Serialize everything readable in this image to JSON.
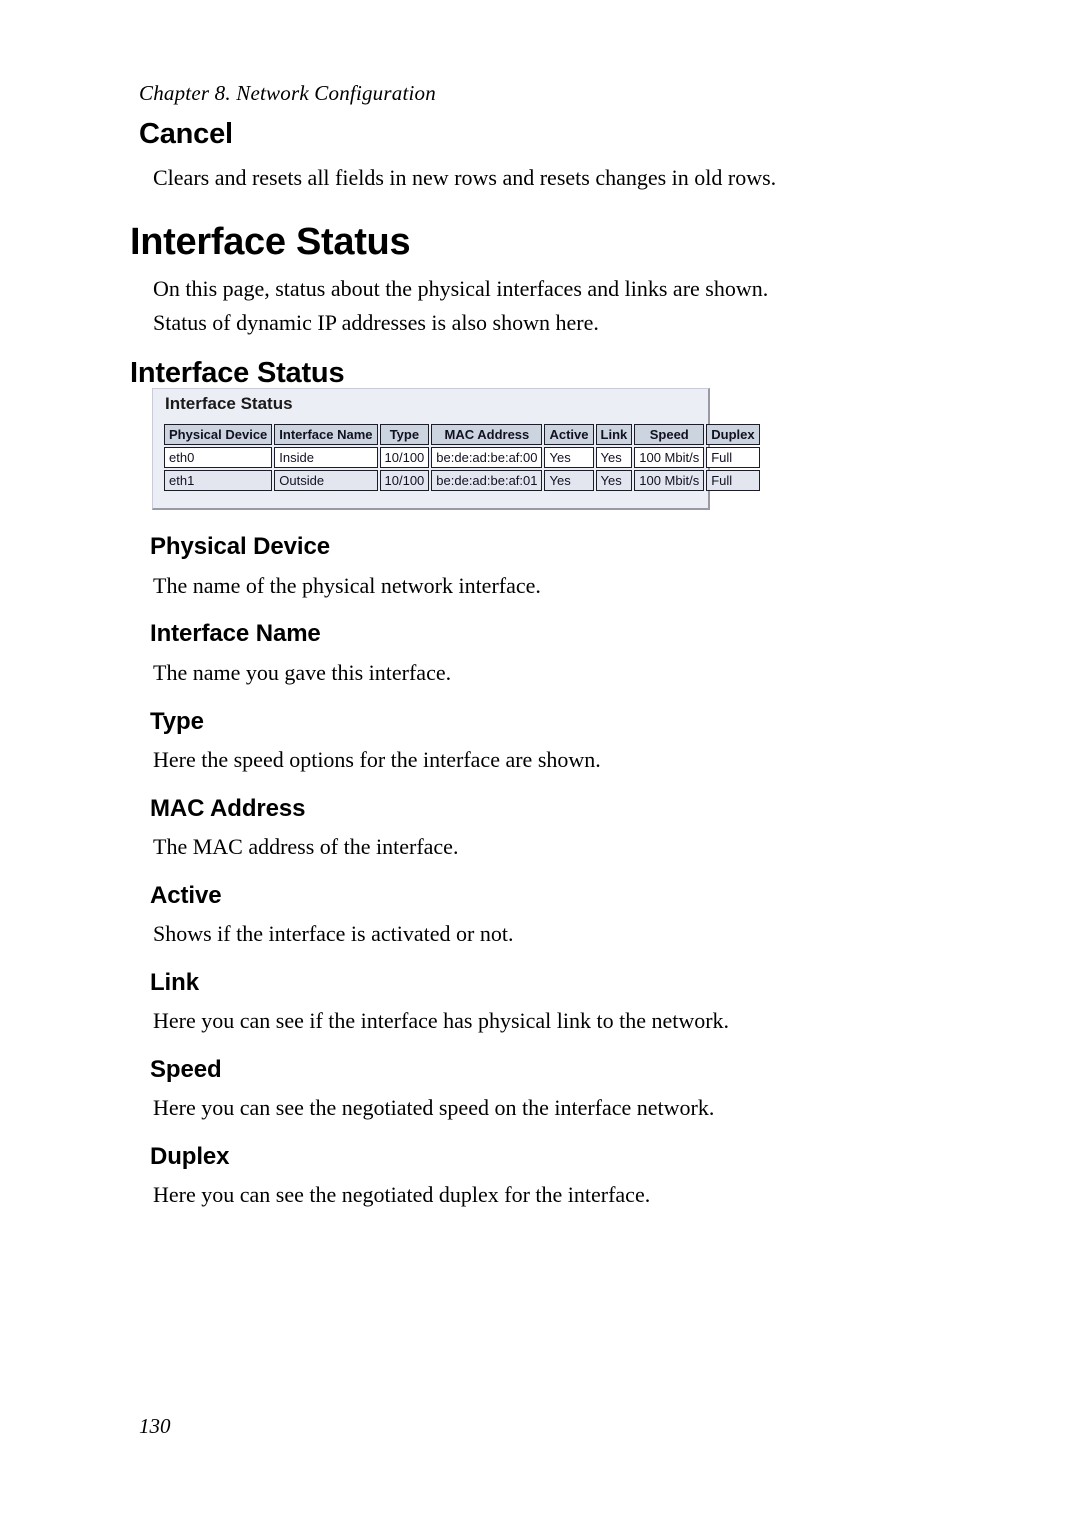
{
  "page": {
    "running_head": "Chapter 8. Network Configuration",
    "folio": "130"
  },
  "sections": {
    "cancel": {
      "heading": "Cancel",
      "body": "Clears and resets all fields in new rows and resets changes in old rows."
    },
    "interface_status": {
      "heading": "Interface Status",
      "body_line1": "On this page, status about the physical interfaces and links are shown.",
      "body_line2": "Status of dynamic IP addresses is also shown here.",
      "subheading": "Interface Status"
    },
    "physical_device": {
      "heading": "Physical Device",
      "body": "The name of the physical network interface."
    },
    "interface_name": {
      "heading": "Interface Name",
      "body": "The name you gave this interface."
    },
    "type": {
      "heading": "Type",
      "body": "Here the speed options for the interface are shown."
    },
    "mac_address": {
      "heading": "MAC Address",
      "body": "The MAC address of the interface."
    },
    "active": {
      "heading": "Active",
      "body": "Shows if the interface is activated or not."
    },
    "link": {
      "heading": "Link",
      "body": "Here you can see if the interface has physical link to the network."
    },
    "speed": {
      "heading": "Speed",
      "body": "Here you can see the negotiated speed on the interface network."
    },
    "duplex": {
      "heading": "Duplex",
      "body": "Here you can see the negotiated duplex for the interface."
    }
  },
  "screenshot": {
    "panel_title": "Interface Status",
    "colors": {
      "panel_background": "#eceef5",
      "header_cell_background": "#ccd4e0",
      "row_odd_background": "#ffffff",
      "row_even_background": "#e3e6ef",
      "cell_border": "#1c1c28"
    },
    "table": {
      "columns": [
        "Physical Device",
        "Interface Name",
        "Type",
        "MAC Address",
        "Active",
        "Link",
        "Speed",
        "Duplex"
      ],
      "rows": [
        {
          "physical_device": "eth0",
          "interface_name": "Inside",
          "type": "10/100",
          "mac_address": "be:de:ad:be:af:00",
          "active": "Yes",
          "link": "Yes",
          "speed": "100 Mbit/s",
          "duplex": "Full"
        },
        {
          "physical_device": "eth1",
          "interface_name": "Outside",
          "type": "10/100",
          "mac_address": "be:de:ad:be:af:01",
          "active": "Yes",
          "link": "Yes",
          "speed": "100 Mbit/s",
          "duplex": "Full"
        }
      ]
    }
  }
}
